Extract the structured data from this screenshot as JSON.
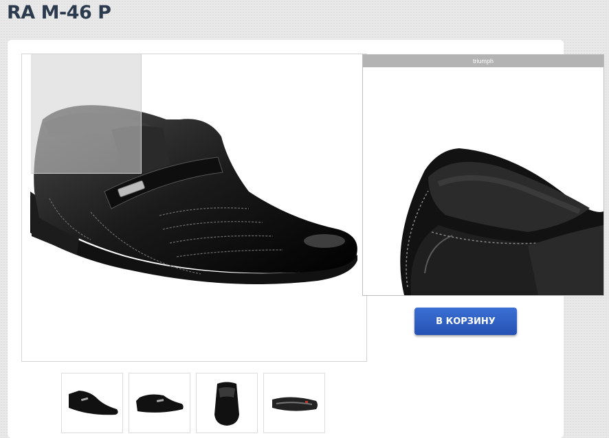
{
  "product": {
    "title": "RA M-46 P",
    "zoom_caption": "triumph",
    "cart_button_label": "В КОРЗИНУ"
  },
  "thumbnails": [
    {
      "name": "shoe-side-view"
    },
    {
      "name": "shoe-profile-view"
    },
    {
      "name": "shoe-front-view"
    },
    {
      "name": "shoe-sole-view"
    }
  ],
  "colors": {
    "title": "#2b3a4d",
    "button": "#2f5fc7",
    "zoom_header": "#b3b3b3"
  }
}
